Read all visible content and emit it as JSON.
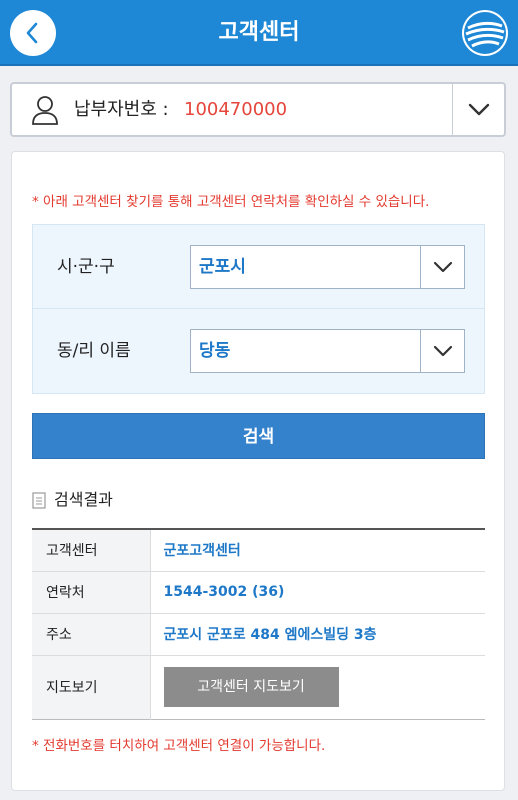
{
  "header": {
    "title": "고객센터"
  },
  "payer": {
    "label": "납부자번호 :",
    "value": "100470000"
  },
  "notice_top": "* 아래 고객센터 찾기를 통해 고객센터 연락처를 확인하실 수 있습니다.",
  "search": {
    "district": {
      "label": "시·군·구",
      "value": "군포시"
    },
    "dong": {
      "label": "동/리 이름",
      "value": "당동"
    },
    "button_label": "검색"
  },
  "results": {
    "title": "검색결과",
    "rows": [
      {
        "key": "고객센터",
        "value": "군포고객센터"
      },
      {
        "key": "연락처",
        "value": "1544-3002 (36)"
      },
      {
        "key": "주소",
        "value": "군포시 군포로 484 엠에스빌딩 3층"
      },
      {
        "key": "지도보기",
        "value": "고객센터 지도보기"
      }
    ]
  },
  "notice_bottom": "* 전화번호를 터치하여 고객센터 연결이 가능합니다.",
  "colors": {
    "header": "#1e88d6",
    "accent_text": "#1e78c8",
    "warning": "#e33a2f",
    "search_button": "#3481cc"
  }
}
